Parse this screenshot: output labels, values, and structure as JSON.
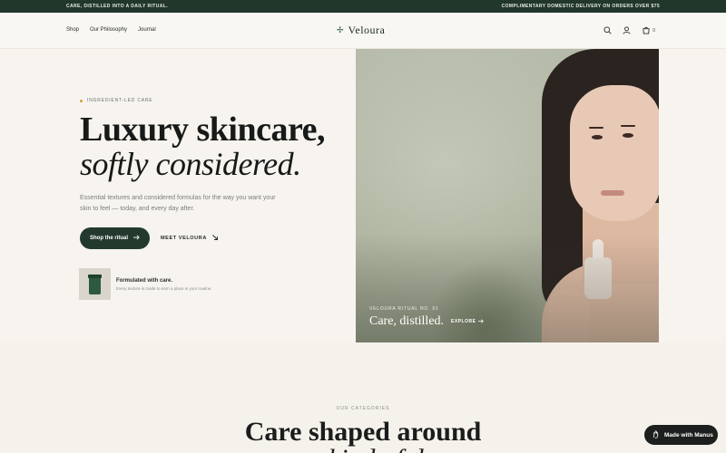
{
  "announce": {
    "left": "CARE, DISTILLED INTO A DAILY RITUAL.",
    "right": "COMPLIMENTARY DOMESTIC DELIVERY ON ORDERS OVER $75"
  },
  "nav": {
    "links": [
      "Shop",
      "Our Philosophy",
      "Journal"
    ],
    "brand": "Veloura",
    "cart_count": "0",
    "icons": [
      "search-icon",
      "account-icon",
      "cart-icon"
    ]
  },
  "hero": {
    "eyebrow": "INGREDIENT-LED CARE",
    "title_line1": "Luxury skincare,",
    "title_line2": "softly considered.",
    "subtitle": "Essential textures and considered formulas for the way you want your skin to feel — today, and every day after.",
    "primary_cta": "Shop the ritual",
    "secondary_cta": "MEET VELOURA"
  },
  "promo": {
    "title": "Formulated with care.",
    "text": "Every texture is made to earn a place in your routine."
  },
  "image_caption": {
    "kicker": "VELOURA RITUAL NO. 01",
    "title": "Care, distilled.",
    "link": "EXPLORE"
  },
  "categories": {
    "kicker": "OUR CATEGORIES",
    "heading_line1": "Care shaped around",
    "heading_line2": "your kind of day."
  },
  "badge": {
    "label": "Made with Manus"
  },
  "colors": {
    "brand_green": "#24392e",
    "accent_dot": "#d39b3f",
    "bg": "#f7f4ef"
  }
}
